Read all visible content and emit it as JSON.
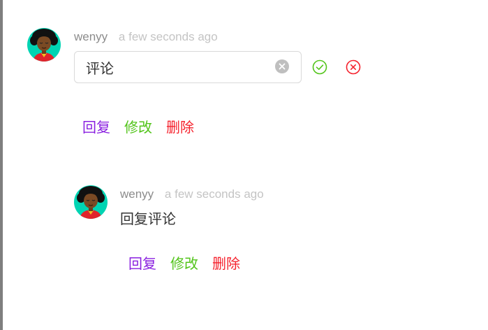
{
  "colors": {
    "reply": "#8a20e0",
    "edit": "#52c41a",
    "delete": "#f5222d",
    "confirm": "#52c41a",
    "cancel": "#f5222d",
    "avatar_bg": "#00d4b3"
  },
  "icons": {
    "avatar": "avatar-icon",
    "clear": "clear-circle-icon",
    "confirm": "check-circle-icon",
    "cancel": "close-circle-icon"
  },
  "comment": {
    "author": "wenyy",
    "time": "a few seconds ago",
    "edit_value": "评论",
    "actions": {
      "reply": "回复",
      "edit": "修改",
      "delete": "删除"
    }
  },
  "reply": {
    "author": "wenyy",
    "time": "a few seconds ago",
    "content": "回复评论",
    "actions": {
      "reply": "回复",
      "edit": "修改",
      "delete": "删除"
    }
  }
}
